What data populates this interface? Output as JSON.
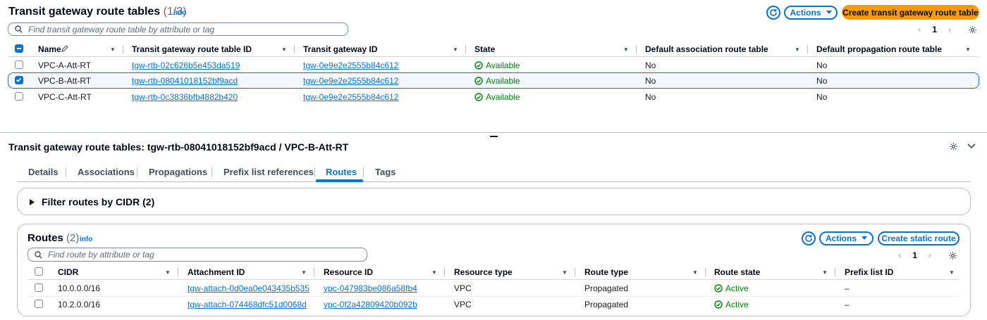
{
  "top": {
    "title": "Transit gateway route tables",
    "count": "(1/3)",
    "info": "info",
    "actions_label": "Actions",
    "create_label": "Create transit gateway route table",
    "search_placeholder": "Find transit gateway route table by attribute or tag",
    "page": "1",
    "columns": [
      "Name",
      "Transit gateway route table ID",
      "Transit gateway ID",
      "State",
      "Default association route table",
      "Default propagation route table"
    ],
    "rows": [
      {
        "name": "VPC-A-Att-RT",
        "rt_id": "tgw-rtb-02c626b5e453da519",
        "tgw_id": "tgw-0e9e2e2555b84c612",
        "state": "Available",
        "assoc": "No",
        "prop": "No",
        "selected": false
      },
      {
        "name": "VPC-B-Att-RT",
        "rt_id": "tgw-rtb-08041018152bf9acd",
        "tgw_id": "tgw-0e9e2e2555b84c612",
        "state": "Available",
        "assoc": "No",
        "prop": "No",
        "selected": true
      },
      {
        "name": "VPC-C-Att-RT",
        "rt_id": "tgw-rtb-0c3836bfb4882b420",
        "tgw_id": "tgw-0e9e2e2555b84c612",
        "state": "Available",
        "assoc": "No",
        "prop": "No",
        "selected": false
      }
    ]
  },
  "detail": {
    "title": "Transit gateway route tables: tgw-rtb-08041018152bf9acd / VPC-B-Att-RT",
    "tabs": [
      "Details",
      "Associations",
      "Propagations",
      "Prefix list references",
      "Routes",
      "Tags"
    ],
    "active_tab": "Routes",
    "filter_label": "Filter routes by CIDR (2)"
  },
  "routes": {
    "title": "Routes",
    "count": "(2)",
    "info": "info",
    "actions_label": "Actions",
    "create_label": "Create static route",
    "search_placeholder": "Find route by attribute or tag",
    "page": "1",
    "columns": [
      "CIDR",
      "Attachment ID",
      "Resource ID",
      "Resource type",
      "Route type",
      "Route state",
      "Prefix list ID"
    ],
    "rows": [
      {
        "cidr": "10.0.0.0/16",
        "attachment": "tgw-attach-0d0ea0e043435b535",
        "resource": "vpc-047983be086a58fb4",
        "rtype": "VPC",
        "route_type": "Propagated",
        "state": "Active",
        "prefix": "–"
      },
      {
        "cidr": "10.2.0.0/16",
        "attachment": "tgw-attach-074468dfc51d0068d",
        "resource": "vpc-0f2a42809420b092b",
        "rtype": "VPC",
        "route_type": "Propagated",
        "state": "Active",
        "prefix": "–"
      }
    ]
  },
  "colors": {
    "accent": "#0972d3",
    "primary": "#ff9900",
    "success": "#037f0c"
  }
}
